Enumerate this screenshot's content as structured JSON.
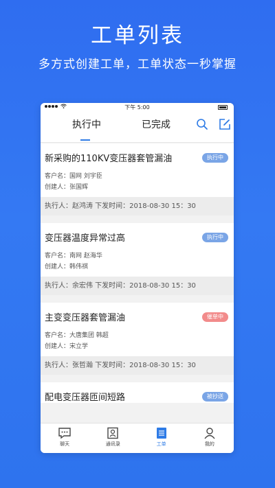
{
  "promo": {
    "title": "工单列表",
    "subtitle": "多方式创建工单，工单状态一秒掌握"
  },
  "status_bar": {
    "time": "下午 5:00"
  },
  "tabs": {
    "active": "执行中",
    "done": "已完成"
  },
  "icons": {
    "search": "search-icon",
    "edit": "edit-icon"
  },
  "colors": {
    "accent": "#2e7be6",
    "badge_blue": "#7aa5e6",
    "badge_red": "#f28b8b",
    "bg_blue": "#2f6df0"
  },
  "orders": [
    {
      "title": "新采购的110KV变压器套管漏油",
      "status": "执行中",
      "client": "客户名：国网  刘宇臣",
      "creator": "创建人：张国辉",
      "footer": "执行人：赵鸿涛   下发时间：2018-08-30 15：30"
    },
    {
      "title": "变压器温度异常过高",
      "status": "执行中",
      "client": "客户名：南网  赵海华",
      "creator": "创建人：韩伟祺",
      "footer": "执行人：余宏伟   下发时间：2018-08-30 15：30"
    },
    {
      "title": "主变变压器套管漏油",
      "status": "催单中",
      "client": "客户名：大唐集团  韩超",
      "creator": "创建人：宋立学",
      "footer": "执行人：张哲瀚   下发时间：2018-08-30 15：30"
    },
    {
      "title": "配电变压器匝间短路",
      "status": "被抄送"
    }
  ],
  "tabbar": {
    "chat": "聊天",
    "contacts": "通讯录",
    "orders": "工单",
    "mine": "我的"
  }
}
